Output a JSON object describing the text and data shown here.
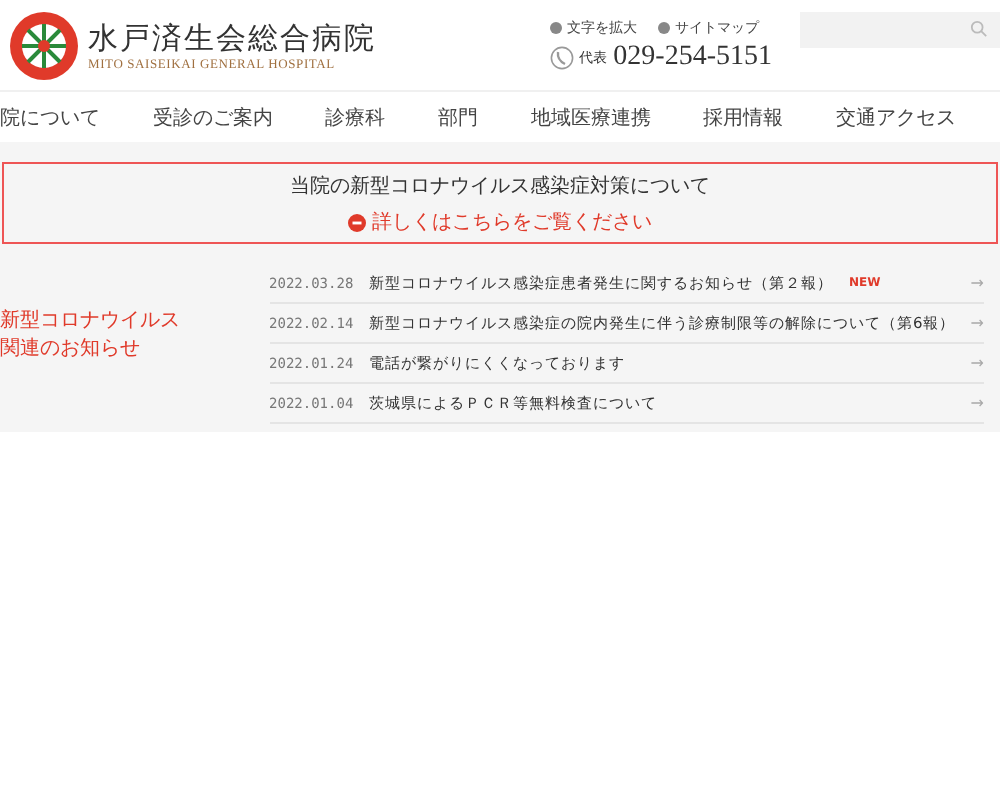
{
  "header": {
    "title": "水戸済生会総合病院",
    "subtitle": "MITO SAISEIKAI GENERAL HOSPITAL",
    "links": [
      "文字を拡大",
      "サイトマップ"
    ],
    "phone_label": "代表",
    "phone": "029-254-5151"
  },
  "nav": [
    "院について",
    "受診のご案内",
    "診療科",
    "部門",
    "地域医療連携",
    "採用情報",
    "交通アクセス"
  ],
  "notice": {
    "title": "当院の新型コロナウイルス感染症対策について",
    "link": "詳しくはこちらをご覧ください"
  },
  "news": {
    "heading": [
      "新型コロナウイルス",
      "関連のお知らせ"
    ],
    "items": [
      {
        "date": "2022.03.28",
        "title": "新型コロナウイルス感染症患者発生に関するお知らせ（第２報）",
        "badge": "NEW",
        "arrow": "→"
      },
      {
        "date": "2022.02.14",
        "title": "新型コロナウイルス感染症の院内発生に伴う診療制限等の解除について（第6報）",
        "arrow": "→"
      },
      {
        "date": "2022.01.24",
        "title": "電話が繋がりにくくなっております",
        "arrow": "→"
      },
      {
        "date": "2022.01.04",
        "title": "茨城県によるＰＣＲ等無料検査について",
        "arrow": "→"
      }
    ]
  }
}
